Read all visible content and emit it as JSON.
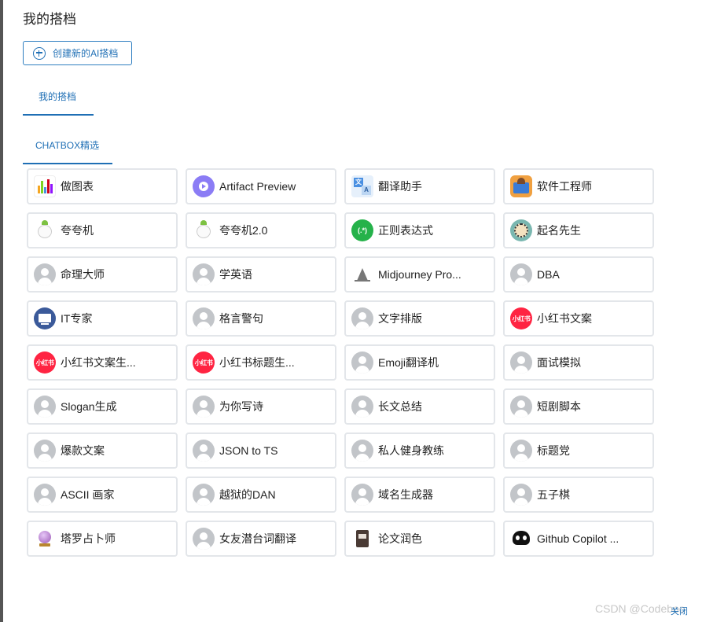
{
  "dialog": {
    "title": "我的搭档"
  },
  "create_button": {
    "label": "创建新的AI搭档"
  },
  "tabs": [
    {
      "label": "我的搭档"
    },
    {
      "label": "CHATBOX精选"
    }
  ],
  "copilots": [
    {
      "name": "做图表",
      "icon": "chart-icon"
    },
    {
      "name": "Artifact Preview",
      "icon": "play-icon"
    },
    {
      "name": "翻译助手",
      "icon": "translate-icon"
    },
    {
      "name": "软件工程师",
      "icon": "engineer-icon"
    },
    {
      "name": "夸夸机",
      "icon": "mascot-icon"
    },
    {
      "name": "夸夸机2.0",
      "icon": "mascot-icon"
    },
    {
      "name": "正则表达式",
      "icon": "regex-icon",
      "glyph": "(.*)"
    },
    {
      "name": "起名先生",
      "icon": "naming-icon"
    },
    {
      "name": "命理大师",
      "icon": "default-avatar-icon"
    },
    {
      "name": "学英语",
      "icon": "default-avatar-icon"
    },
    {
      "name": "Midjourney Pro...",
      "icon": "sailboat-icon"
    },
    {
      "name": "DBA",
      "icon": "default-avatar-icon"
    },
    {
      "name": "IT专家",
      "icon": "monitor-icon"
    },
    {
      "name": "格言警句",
      "icon": "default-avatar-icon"
    },
    {
      "name": "文字排版",
      "icon": "default-avatar-icon"
    },
    {
      "name": "小红书文案",
      "icon": "xiaohongshu-icon",
      "glyph": "小红书"
    },
    {
      "name": "小红书文案生...",
      "icon": "xiaohongshu-icon",
      "glyph": "小红书"
    },
    {
      "name": "小红书标题生...",
      "icon": "xiaohongshu-icon",
      "glyph": "小红书"
    },
    {
      "name": "Emoji翻译机",
      "icon": "default-avatar-icon"
    },
    {
      "name": "面试模拟",
      "icon": "default-avatar-icon"
    },
    {
      "name": "Slogan生成",
      "icon": "default-avatar-icon"
    },
    {
      "name": "为你写诗",
      "icon": "default-avatar-icon"
    },
    {
      "name": "长文总结",
      "icon": "default-avatar-icon"
    },
    {
      "name": "短剧脚本",
      "icon": "default-avatar-icon"
    },
    {
      "name": "爆款文案",
      "icon": "default-avatar-icon"
    },
    {
      "name": "JSON to TS",
      "icon": "default-avatar-icon"
    },
    {
      "name": "私人健身教练",
      "icon": "default-avatar-icon"
    },
    {
      "name": "标题党",
      "icon": "default-avatar-icon"
    },
    {
      "name": "ASCII 画家",
      "icon": "default-avatar-icon"
    },
    {
      "name": "越狱的DAN",
      "icon": "default-avatar-icon"
    },
    {
      "name": "域名生成器",
      "icon": "default-avatar-icon"
    },
    {
      "name": "五子棋",
      "icon": "default-avatar-icon"
    },
    {
      "name": "塔罗占卜师",
      "icon": "crystal-ball-icon"
    },
    {
      "name": "女友潜台词翻译",
      "icon": "default-avatar-icon"
    },
    {
      "name": "论文润色",
      "icon": "book-icon"
    },
    {
      "name": "Github Copilot ...",
      "icon": "github-icon"
    }
  ],
  "watermark": "CSDN @Codeboo",
  "close_label": "关闭"
}
